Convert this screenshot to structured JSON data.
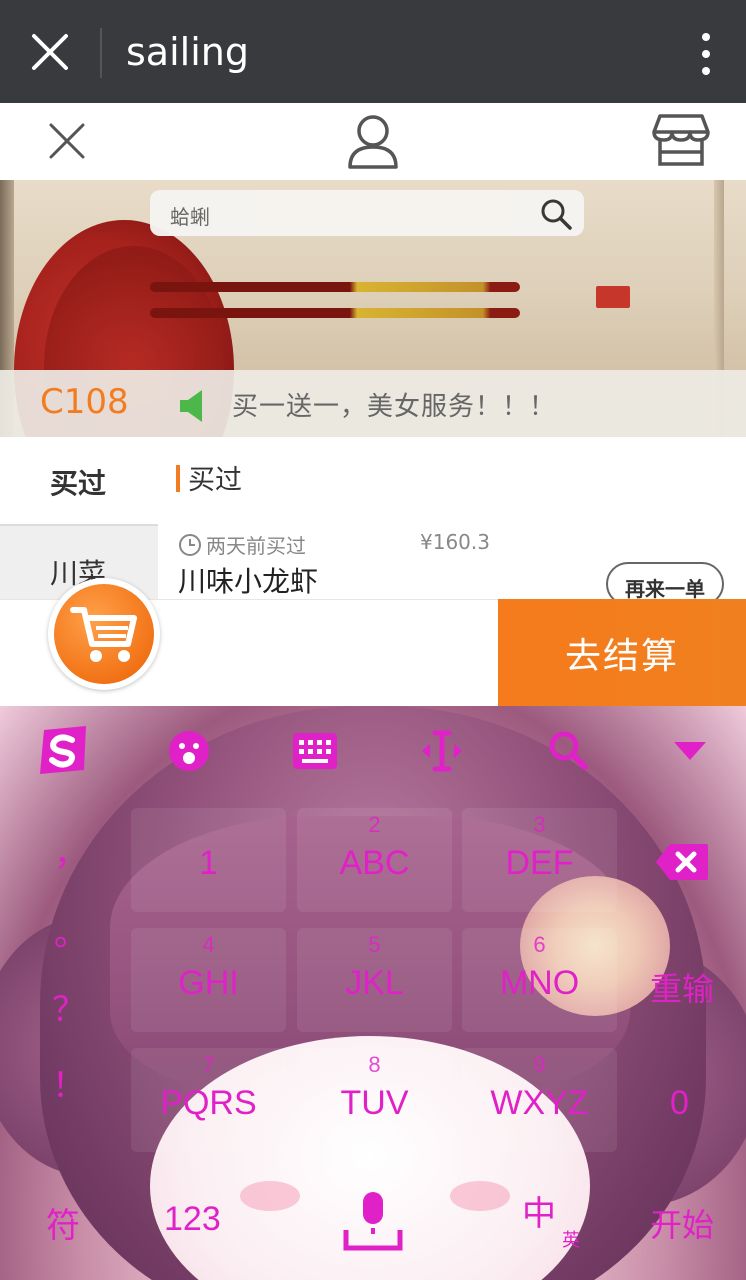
{
  "topbar": {
    "title": "sailing",
    "close_icon": "close-icon",
    "menu_icon": "more-vertical-icon"
  },
  "subbar": {
    "close_icon": "close-icon",
    "user_icon": "user-icon",
    "store_icon": "store-icon"
  },
  "search": {
    "placeholder": "蛤蜊"
  },
  "notice": {
    "table_code": "C108",
    "text": "买一送一，美女服务！！！"
  },
  "categories": [
    {
      "label": "买过",
      "selected": true
    },
    {
      "label": "川菜",
      "selected": false
    }
  ],
  "section": {
    "title": "买过"
  },
  "order": {
    "time": "两天前买过",
    "price": "¥160.3",
    "name": "川味小龙虾",
    "reorder_label": "再来一单"
  },
  "actions": {
    "checkout_label": "去结算"
  },
  "keyboard": {
    "toolbar": [
      "sogou-logo-icon",
      "emoji-icon",
      "keyboard-icon",
      "cursor-icon",
      "search-icon",
      "hide-keyboard-icon"
    ],
    "left_punct": [
      "，",
      "。",
      "？",
      "！"
    ],
    "keys": [
      {
        "num": "",
        "label": "1"
      },
      {
        "num": "2",
        "label": "ABC"
      },
      {
        "num": "3",
        "label": "DEF"
      },
      {
        "num": "4",
        "label": "GHI"
      },
      {
        "num": "5",
        "label": "JKL"
      },
      {
        "num": "6",
        "label": "MNO"
      },
      {
        "num": "7",
        "label": "PQRS"
      },
      {
        "num": "8",
        "label": "TUV"
      },
      {
        "num": "9",
        "label": "WXYZ"
      }
    ],
    "right": {
      "retype": "重输",
      "zero": "0",
      "start": "开始"
    },
    "bottom": {
      "symbols": "符",
      "num": "123",
      "lang": "中",
      "lang_sub": "英"
    },
    "accent": "#e021c8"
  },
  "colors": {
    "brand_orange": "#f27c22",
    "topbar": "#383a3d"
  }
}
